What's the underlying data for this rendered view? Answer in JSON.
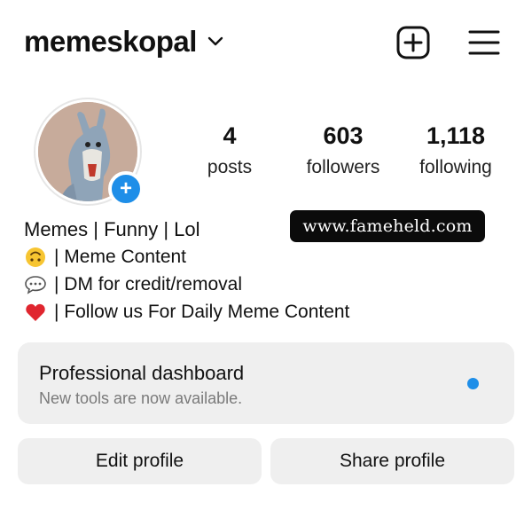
{
  "header": {
    "username": "memeskopal",
    "icons": {
      "dropdown": "chevron-down-icon",
      "create": "add-square-icon",
      "menu": "hamburger-menu-icon"
    }
  },
  "profile": {
    "avatar_badge": "+",
    "stats": [
      {
        "value": "4",
        "label": "posts"
      },
      {
        "value": "603",
        "label": "followers"
      },
      {
        "value": "1,118",
        "label": "following"
      }
    ],
    "bio": {
      "name": "Memes | Funny | Lol",
      "lines": [
        {
          "emoji": "upside-down-face-icon",
          "text": "| Meme Content"
        },
        {
          "emoji": "speech-bubble-icon",
          "text": "| DM for credit/removal"
        },
        {
          "emoji": "red-heart-icon",
          "text": "| Follow us For Daily Meme Content"
        }
      ]
    },
    "watermark": "www.fameheld.com"
  },
  "dashboard": {
    "title": "Professional dashboard",
    "subtitle": "New tools are now available.",
    "dot_color": "#1e8ee8"
  },
  "buttons": {
    "edit": "Edit profile",
    "share": "Share profile"
  },
  "colors": {
    "accent": "#1e8ee8",
    "button_bg": "#efefef"
  }
}
